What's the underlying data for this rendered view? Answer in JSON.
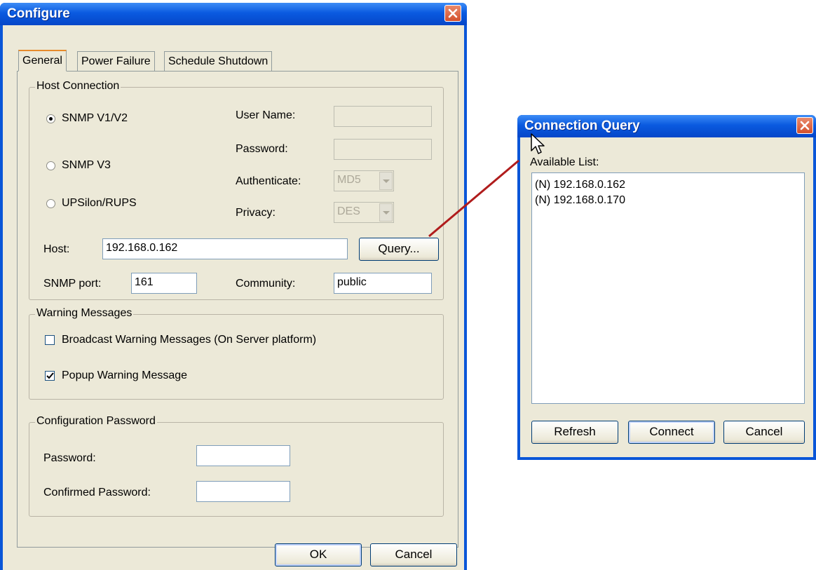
{
  "configure": {
    "title": "Configure",
    "tabs": [
      "General",
      "Power Failure",
      "Schedule Shutdown"
    ],
    "host_connection": {
      "legend": "Host Connection",
      "protocols": [
        {
          "label": "SNMP V1/V2",
          "selected": true
        },
        {
          "label": "SNMP V3",
          "selected": false
        },
        {
          "label": "UPSilon/RUPS",
          "selected": false
        }
      ],
      "user_name_label": "User Name:",
      "user_name_value": "",
      "password_label": "Password:",
      "password_value": "",
      "authenticate_label": "Authenticate:",
      "authenticate_value": "MD5",
      "privacy_label": "Privacy:",
      "privacy_value": "DES",
      "host_label": "Host:",
      "host_value": "192.168.0.162",
      "query_button": "Query...",
      "snmp_port_label": "SNMP port:",
      "snmp_port_value": "161",
      "community_label": "Community:",
      "community_value": "public"
    },
    "warning_messages": {
      "legend": "Warning Messages",
      "broadcast_label": "Broadcast Warning Messages (On Server platform)",
      "broadcast_checked": false,
      "popup_label": "Popup Warning Message",
      "popup_checked": true
    },
    "config_password": {
      "legend": "Configuration Password",
      "password_label": "Password:",
      "password_value": "",
      "confirmed_label": "Confirmed Password:",
      "confirmed_value": ""
    },
    "ok_button": "OK",
    "cancel_button": "Cancel"
  },
  "connection_query": {
    "title": "Connection Query",
    "available_label": "Available List:",
    "items": [
      "(N) 192.168.0.162",
      "(N) 192.168.0.170"
    ],
    "refresh_button": "Refresh",
    "connect_button": "Connect",
    "cancel_button": "Cancel"
  },
  "colors": {
    "titlebar": "#0a5ae0",
    "dialog_face": "#ece9d8",
    "close_button": "#d4502c",
    "connector_arrow": "#b01c1c"
  }
}
